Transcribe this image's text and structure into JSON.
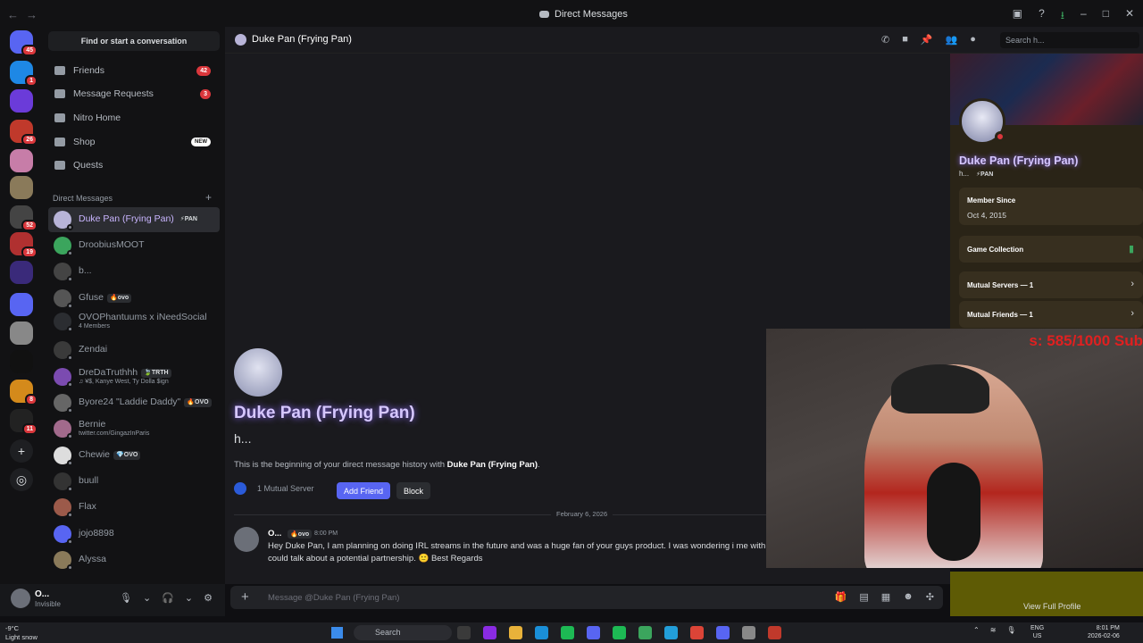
{
  "window": {
    "title": "Direct Messages"
  },
  "sidebar": {
    "find_placeholder": "Find or start a conversation",
    "nav": [
      {
        "label": "Friends",
        "badge": "42"
      },
      {
        "label": "Message Requests",
        "badge": "3"
      },
      {
        "label": "Nitro Home"
      },
      {
        "label": "Shop",
        "pill": "NEW"
      },
      {
        "label": "Quests"
      }
    ],
    "dm_header": "Direct Messages",
    "dms": [
      {
        "name": "Duke Pan (Frying Pan)",
        "tag": "⚡PAN",
        "active": true,
        "avatar_color": "#b8b4d8"
      },
      {
        "name": "DroobiusMOOT",
        "avatar_color": "#3ba55d"
      },
      {
        "name": "b...",
        "avatar_color": "#444"
      },
      {
        "name": "Gfuse",
        "tag": "🔥ovo",
        "avatar_color": "#555"
      },
      {
        "name": "OVOPhantuums x iNeedSocial",
        "sub": "4 Members",
        "avatar_color": "#2b2d31"
      },
      {
        "name": "Zendai",
        "avatar_color": "#3a3a3a"
      },
      {
        "name": "DreDaTruthhh",
        "tag": "🍃TRTH",
        "sub": "♫ ¥$, Kanye West, Ty Dolla $ign",
        "avatar_color": "#7b4bb0"
      },
      {
        "name": "Byore24 \"Laddie Daddy\"",
        "tag": "🔥OVO",
        "avatar_color": "#666"
      },
      {
        "name": "Bernie",
        "sub": "twitter.com/GingazInParis",
        "avatar_color": "#a26a8c"
      },
      {
        "name": "Chewie",
        "tag": "💎OVO",
        "avatar_color": "#ddd"
      },
      {
        "name": "buull",
        "avatar_color": "#333"
      },
      {
        "name": "Flax",
        "avatar_color": "#9c5a4a"
      },
      {
        "name": "jojo8898",
        "avatar_color": "#5865f2"
      },
      {
        "name": "Alyssa",
        "avatar_color": "#8a7a5a"
      }
    ]
  },
  "servers": [
    {
      "badge": "45",
      "color": "#5865f2"
    },
    {
      "badge": "1",
      "color": "#1e88e5"
    },
    {
      "badge": "",
      "color": "#6b3bd9"
    },
    {
      "badge": "26",
      "color": "#c0392b"
    },
    {
      "badge": "",
      "color": "#c77da8"
    },
    {
      "badge": "",
      "color": "#8a7a5a"
    },
    {
      "badge": "52",
      "color": "#444"
    },
    {
      "badge": "19",
      "color": "#b03030"
    },
    {
      "badge": "",
      "color": "#3a2a7a"
    },
    {
      "badge": "",
      "color": "#5865f2"
    },
    {
      "badge": "",
      "color": "#888"
    },
    {
      "badge": "",
      "color": "#111"
    },
    {
      "badge": "8",
      "color": "#d48a1b"
    },
    {
      "badge": "11",
      "color": "#222"
    }
  ],
  "user": {
    "name": "O...",
    "status": "Invisible"
  },
  "header": {
    "name": "Duke Pan (Frying Pan)",
    "search_placeholder": "Search h..."
  },
  "chat": {
    "name": "Duke Pan (Frying Pan)",
    "handle": "h...",
    "beginning_prefix": "This is the beginning of your direct message history with ",
    "beginning_name": "Duke Pan (Frying Pan)",
    "beginning_suffix": ".",
    "mutual": "1 Mutual Server",
    "add_friend": "Add Friend",
    "block": "Block",
    "date_divider": "February 6, 2026",
    "message": {
      "author": "O...",
      "tag": "🔥ovo",
      "time": "8:00 PM",
      "text": "Hey Duke Pan, I am planning on doing IRL streams in the future and was a huge fan of your guys product. I was wondering i me with could talk about a potential partnership. 🙂 Best Regards"
    }
  },
  "composer": {
    "placeholder": "Message @Duke Pan (Frying Pan)"
  },
  "profile": {
    "name": "Duke Pan (Frying Pan)",
    "handle": "h...",
    "tag": "⚡PAN",
    "member_since_label": "Member Since",
    "member_since": "Oct 4, 2015",
    "game_collection": "Game Collection",
    "mutual_servers": "Mutual Servers — 1",
    "mutual_friends": "Mutual Friends — 1",
    "view_full": "View Full Profile"
  },
  "webcam": {
    "overlay_text": "s: 585/1000 Sub"
  },
  "taskbar": {
    "temp": "-9°C",
    "weather": "Light snow",
    "search": "Search",
    "lang1": "ENG",
    "lang2": "US",
    "time": "8:01 PM",
    "date": "2026-02-06"
  }
}
